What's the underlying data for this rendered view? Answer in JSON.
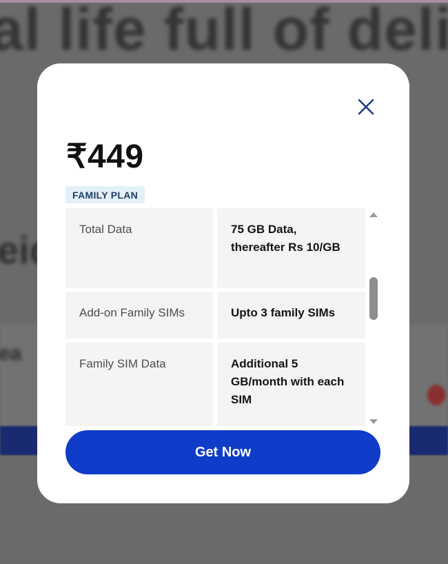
{
  "background": {
    "headline": "al life full of deli",
    "fragment_left": "eid",
    "fragment_band": "ea"
  },
  "modal": {
    "close_icon": "close-icon",
    "price": "₹449",
    "badge": "FAMILY PLAN",
    "rows": [
      {
        "label": "Total Data",
        "value": "75 GB Data, thereafter Rs 10/GB"
      },
      {
        "label": "Add-on Family SIMs",
        "value": "Upto 3 family SIMs"
      },
      {
        "label": "Family SIM Data",
        "value": "Additional 5 GB/month with each SIM"
      }
    ],
    "cta_label": "Get Now"
  },
  "colors": {
    "cta": "#0f3cc9",
    "badge_bg": "#e3f0fa",
    "badge_text": "#1f3f64",
    "close_icon": "#1d3a8a"
  }
}
